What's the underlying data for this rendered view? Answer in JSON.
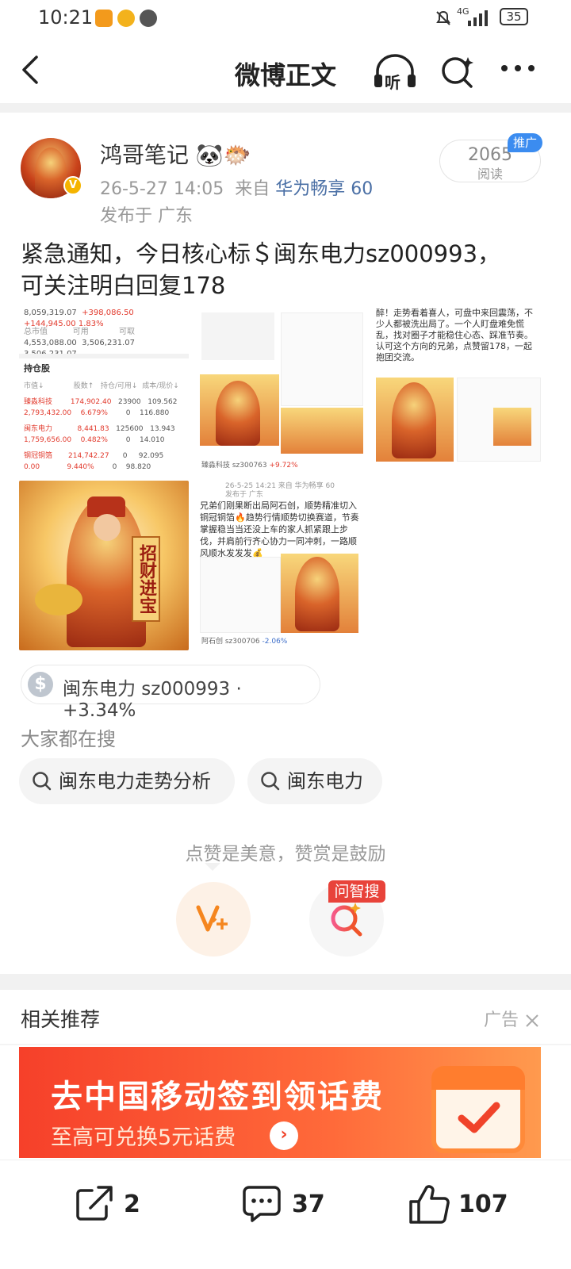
{
  "status_bar": {
    "time": "10:21",
    "battery": "35",
    "network": "4G"
  },
  "nav": {
    "title": "微博正文",
    "listen_label": "听"
  },
  "post": {
    "author": "鸿哥笔记",
    "author_emoji": "🐼🐡",
    "timestamp": "26-5-27 14:05",
    "from_label": "来自",
    "device": "华为畅享 60",
    "location": "发布于 广东",
    "reads": "2065",
    "reads_label": "阅读",
    "promo_badge": "推广",
    "content_line1": "紧急通知，今日核心标＄闽东电力sz000993，",
    "content_line2": "可关注明白回复178"
  },
  "images": {
    "img1": {
      "top_values": [
        "8,059,319.07",
        "+398,086.50",
        "+144,945.00",
        "1.83%"
      ],
      "row_labels": [
        "总市值",
        "可用",
        "可取"
      ],
      "row_values": [
        "4,553,088.00",
        "3,506,231.07",
        "3,506,231.07"
      ],
      "holdings_title": "持仓股",
      "cols": [
        "市值↓",
        "股数↑",
        "持仓/可用↓",
        "成本/现价↓"
      ],
      "rows": [
        {
          "name": "臻淼科技",
          "v1": "174,902.40",
          "v2": "23900",
          "v3": "109.562",
          "sub1": "2,793,432.00",
          "sub2": "6.679%",
          "sub3": "0",
          "sub4": "116.880"
        },
        {
          "name": "闽东电力",
          "v1": "8,441.83",
          "v2": "125600",
          "v3": "13.943",
          "sub1": "1,759,656.00",
          "sub2": "0.482%",
          "sub3": "0",
          "sub4": "14.010"
        },
        {
          "name": "钢冠铜箔",
          "v1": "214,742.27",
          "v2": "0",
          "v3": "92.095",
          "sub1": "0.00",
          "sub2": "9.440%",
          "sub3": "0",
          "sub4": "98.820"
        }
      ]
    },
    "img2": {
      "stock_tag": "臻淼科技 sz300763",
      "stock_change": "+9.72%"
    },
    "img3": {
      "text": "醉！走势看着喜人，可盘中来回震荡，不少人都被洗出局了。一个人盯盘难免慌乱，找对圈子才能稳住心态、踩准节奏。认可这个方向的兄弟，点赞留178，一起抱团交流。"
    },
    "img4": {
      "scroll_text": "招财进宝"
    },
    "img5": {
      "meta": "26-5-25 14:21 来自 华为畅享 60",
      "loc": "发布于 广东",
      "text": "兄弟们刚果断出局阿石创，顺势精准切入铜冠铜箔🔥趋势行情顺势切换赛道，节奏掌握稳当当还没上车的家人抓紧跟上步伐，并肩前行齐心协力一同冲刺，一路顺风顺水发发发💰",
      "stock_tag": "阿石创 sz300706",
      "stock_change": "-2.06%"
    }
  },
  "stock_chip": {
    "icon": "$",
    "text": "闽东电力 sz000993 · +3.34%"
  },
  "searches": {
    "label": "大家都在搜",
    "items": [
      "闽东电力走势分析",
      "闽东电力"
    ]
  },
  "cheer": {
    "text": "点赞是美意，赞赏是鼓励",
    "wzs_badge": "问智搜"
  },
  "related": {
    "label": "相关推荐",
    "ad_label": "广告"
  },
  "ad_banner": {
    "title": "去中国移动签到领话费",
    "subtitle": "至高可兑换5元话费"
  },
  "bottom": {
    "share": "2",
    "comments": "37",
    "likes": "107"
  },
  "colors": {
    "accent": "#f5861f",
    "link": "#4a6fa5",
    "red": "#e23b2e"
  }
}
